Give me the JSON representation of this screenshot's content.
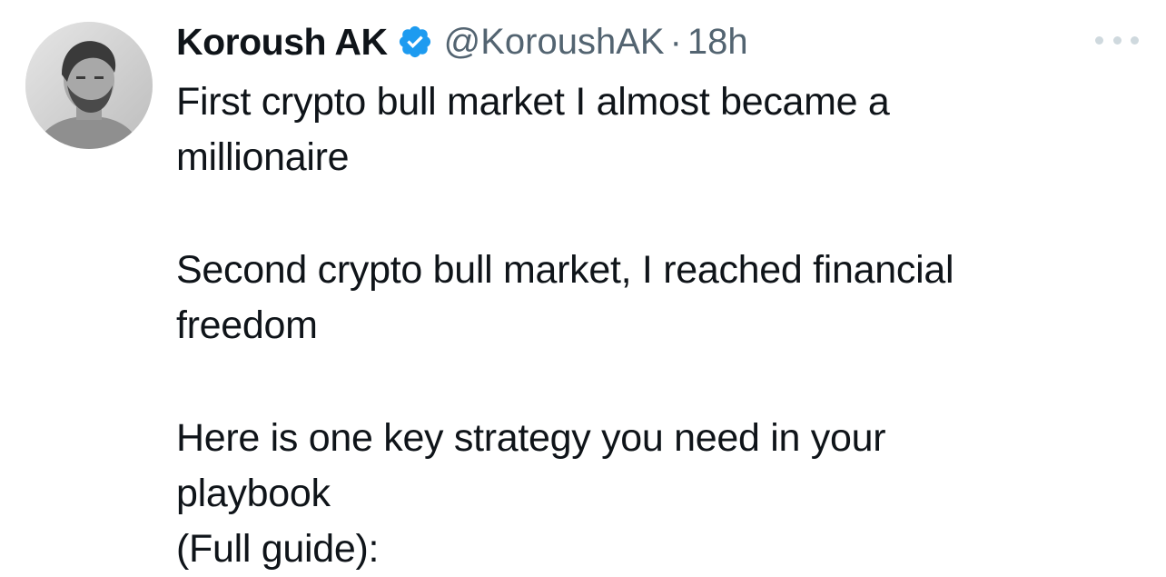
{
  "author": {
    "name": "Koroush AK",
    "handle": "@KoroushAK",
    "separator": "·",
    "time": "18h",
    "verified": true
  },
  "tweet": {
    "paragraphs": [
      [
        "First crypto bull market I almost became a",
        "millionaire"
      ],
      [
        "Second crypto bull market, I reached financial",
        "freedom"
      ],
      [
        "Here is one key strategy you need in your",
        "playbook",
        "(Full guide):"
      ]
    ]
  },
  "icons": {
    "verified": "verified-badge-icon",
    "more": "more-options-icon"
  },
  "colors": {
    "text": "#0f1419",
    "secondary": "#536471",
    "verified": "#1d9bf0",
    "more_dots": "#cfd9de",
    "background": "#ffffff"
  }
}
